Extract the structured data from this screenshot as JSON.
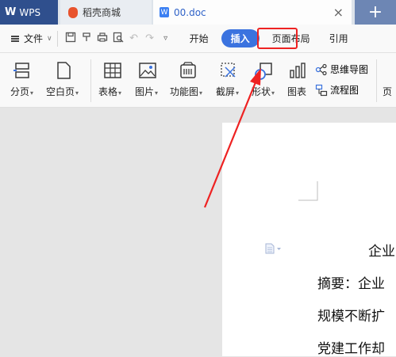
{
  "tabs": {
    "wps": "WPS",
    "shop": "稻壳商城",
    "doc": "00.doc",
    "close": "×",
    "add": "+"
  },
  "menu": {
    "file": "文件",
    "tabs": [
      "开始",
      "插入",
      "页面布局",
      "引用"
    ]
  },
  "ribbon": {
    "page_break": "分页",
    "blank_page": "空白页",
    "table": "表格",
    "image": "图片",
    "feature_chart": "功能图",
    "screenshot": "截屏",
    "shapes": "形状",
    "chart": "图表",
    "mind_map": "思维导图",
    "flowchart": "流程图",
    "header_partial": "页"
  },
  "document": {
    "title_fragment": "企业",
    "line1": "摘要：企业",
    "line2": "规模不断扩",
    "line3": "党建工作却"
  },
  "colors": {
    "accent": "#3b73df",
    "annotation_red": "#ee2222",
    "wps_tab": "#2f4f8d"
  }
}
